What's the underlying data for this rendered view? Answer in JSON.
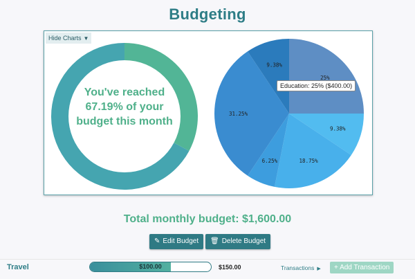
{
  "page": {
    "title": "Budgeting"
  },
  "charts": {
    "hide_label": "Hide Charts",
    "donut": {
      "message": "You've reached 67.19% of your budget this month",
      "percent_reached": 67.19,
      "colors": {
        "spent": "#45a5b0",
        "remaining": "#52b596",
        "inner": "#ffffff"
      }
    },
    "pie": {
      "slices": [
        {
          "label": "25%",
          "value": 25,
          "color": "#5e8ec4"
        },
        {
          "label": "9.38%",
          "value": 9.38,
          "color": "#52bcf0"
        },
        {
          "label": "18.75%",
          "value": 18.75,
          "color": "#48b0eb"
        },
        {
          "label": "6.25%",
          "value": 6.25,
          "color": "#3d9dde"
        },
        {
          "label": "31.25%",
          "value": 31.25,
          "color": "#3a8cd0"
        },
        {
          "label": "9.38%",
          "value": 9.38,
          "color": "#2b7bbc"
        }
      ]
    },
    "tooltip": "Education: 25% ($400.00)"
  },
  "chart_data": {
    "type": "pie",
    "series": [
      {
        "values": [
          25,
          9.38,
          18.75,
          6.25,
          31.25,
          9.38
        ]
      }
    ],
    "categories": [
      "25%",
      "9.38%",
      "18.75%",
      "6.25%",
      "31.25%",
      "9.38%"
    ],
    "annotations": [
      "Education: 25% ($400.00)"
    ]
  },
  "summary": {
    "total_budget": "Total monthly budget: $1,600.00"
  },
  "actions": {
    "edit_label": "Edit Budget",
    "delete_label": "Delete Budget"
  },
  "budget_row": {
    "category": "Travel",
    "spent": "$100.00",
    "spent_fraction": 0.6667,
    "budget": "$150.00",
    "transactions_label": "Transactions",
    "add_transaction_label": "Add Transaction"
  },
  "icons": {
    "caret": "caret-down-icon",
    "edit": "pencil-icon",
    "delete": "trash-icon",
    "arrow": "caret-right-icon",
    "add": "plus-icon"
  }
}
